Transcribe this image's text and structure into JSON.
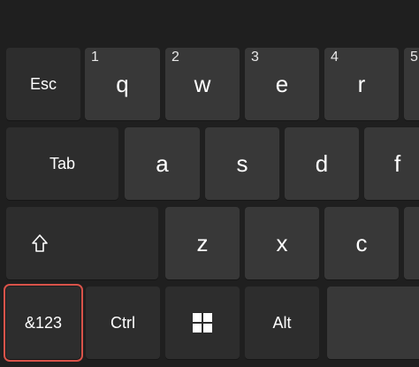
{
  "row1": {
    "esc": "Esc",
    "keys": [
      {
        "hint": "1",
        "label": "q"
      },
      {
        "hint": "2",
        "label": "w"
      },
      {
        "hint": "3",
        "label": "e"
      },
      {
        "hint": "4",
        "label": "r"
      },
      {
        "hint": "5",
        "label": ""
      }
    ]
  },
  "row2": {
    "tab": "Tab",
    "keys": [
      "a",
      "s",
      "d",
      "f"
    ]
  },
  "row3": {
    "shift_icon": "shift-up-arrow-icon",
    "keys": [
      "z",
      "x",
      "c"
    ]
  },
  "row4": {
    "symbols": "&123",
    "ctrl": "Ctrl",
    "windows_icon": "windows-logo-icon",
    "alt": "Alt",
    "space": ""
  },
  "colors": {
    "background": "#1f1f1f",
    "key": "#383838",
    "function_key": "#2d2d2d",
    "text": "#ffffff",
    "selection_outline": "#d9534a"
  }
}
